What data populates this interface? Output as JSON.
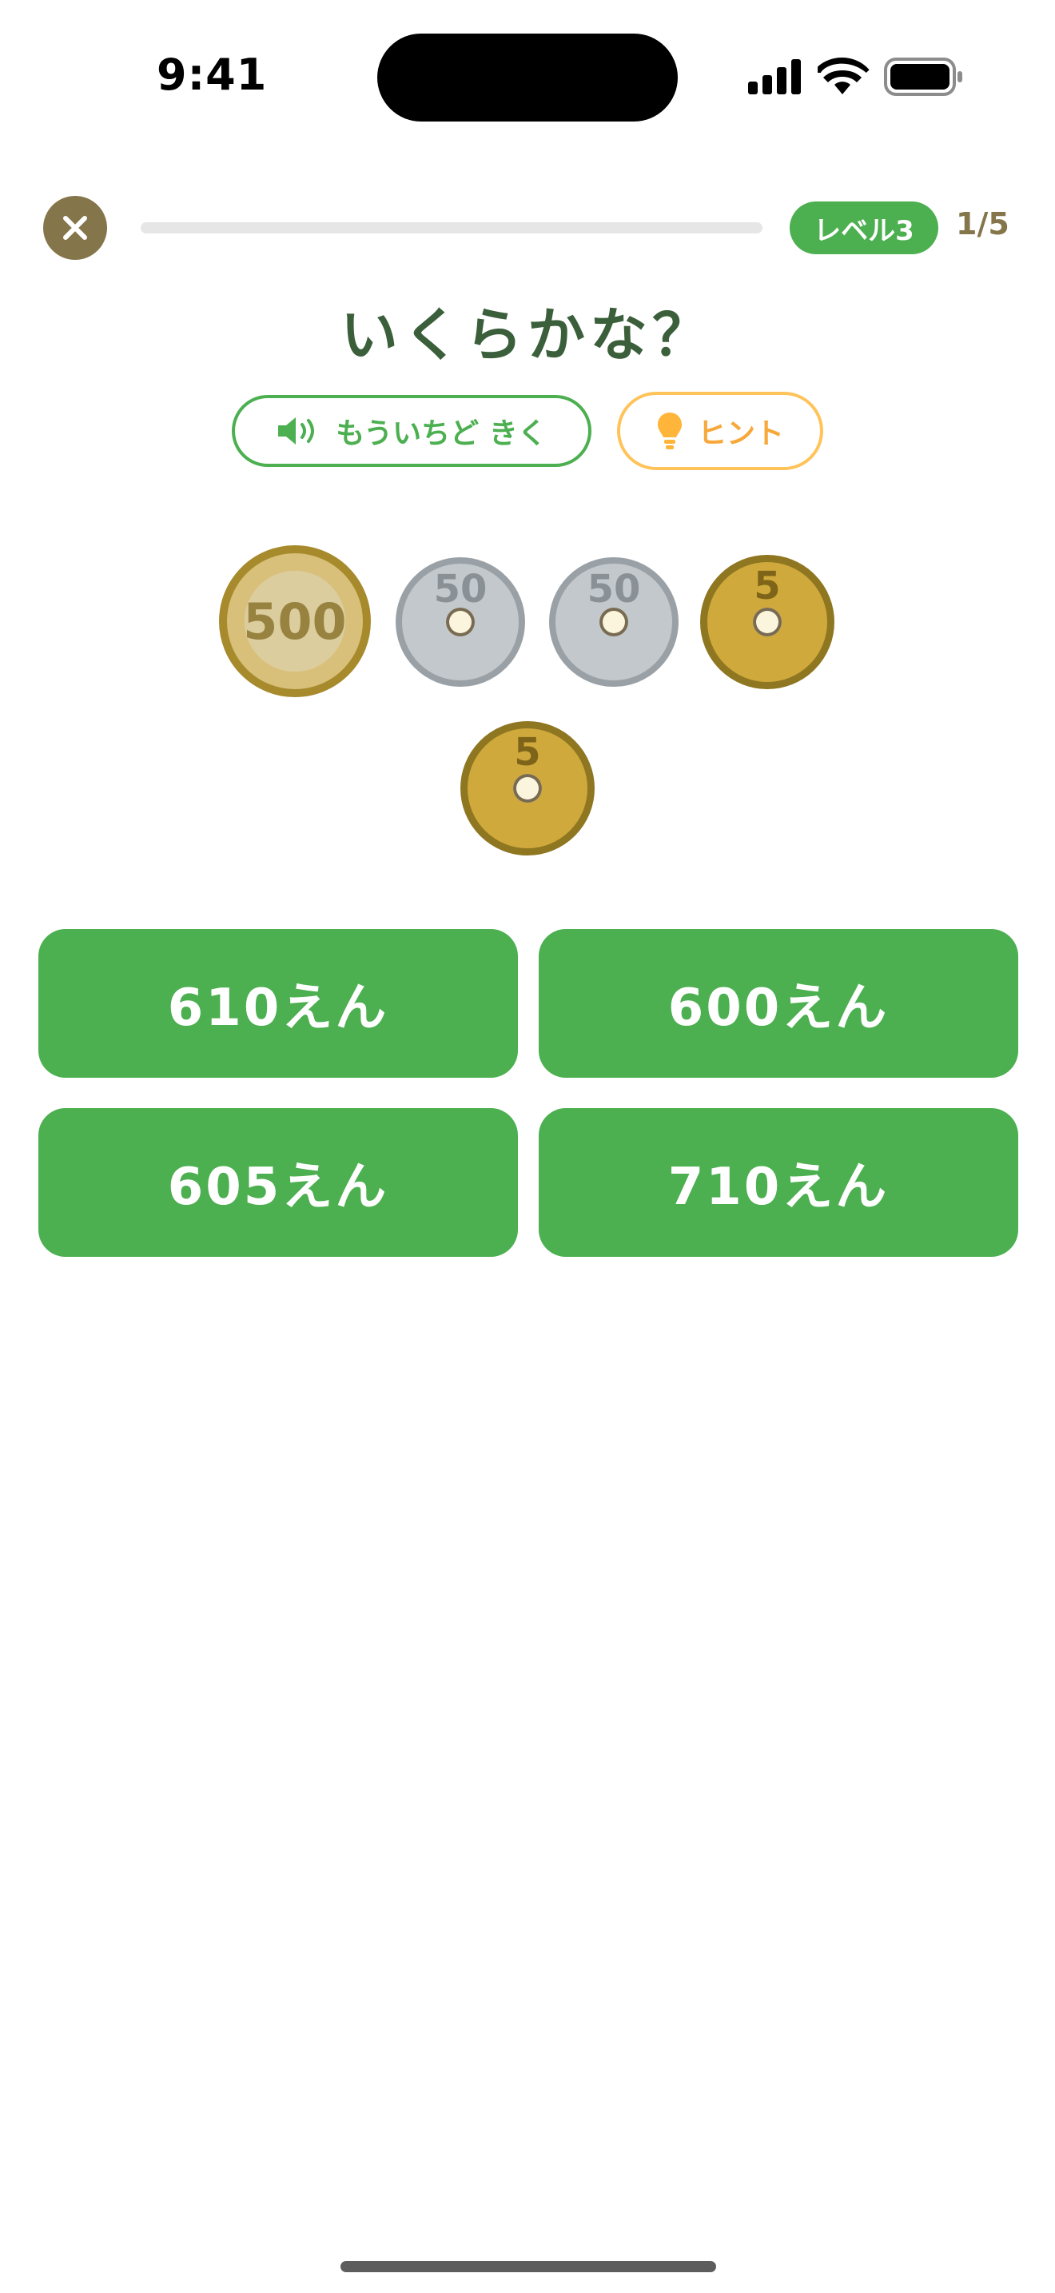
{
  "status_bar": {
    "time": "9:41"
  },
  "header": {
    "level": "レベル3",
    "counter": "1/5",
    "progress": 0
  },
  "question": {
    "title": "いくらかな？"
  },
  "actions": {
    "replay_label": "もういちど きく",
    "hint_label": "ヒント"
  },
  "coins": [
    {
      "value": "500",
      "kind": "500-yen"
    },
    {
      "value": "50",
      "kind": "50-yen"
    },
    {
      "value": "50",
      "kind": "50-yen"
    },
    {
      "value": "5",
      "kind": "5-yen"
    },
    {
      "value": "5",
      "kind": "5-yen"
    }
  ],
  "answers": [
    "610えん",
    "600えん",
    "605えん",
    "710えん"
  ],
  "colors": {
    "accent_green": "#4caf50",
    "hint_orange": "#ffc35a",
    "title_green": "#3b5f3b",
    "brown": "#84754a"
  }
}
